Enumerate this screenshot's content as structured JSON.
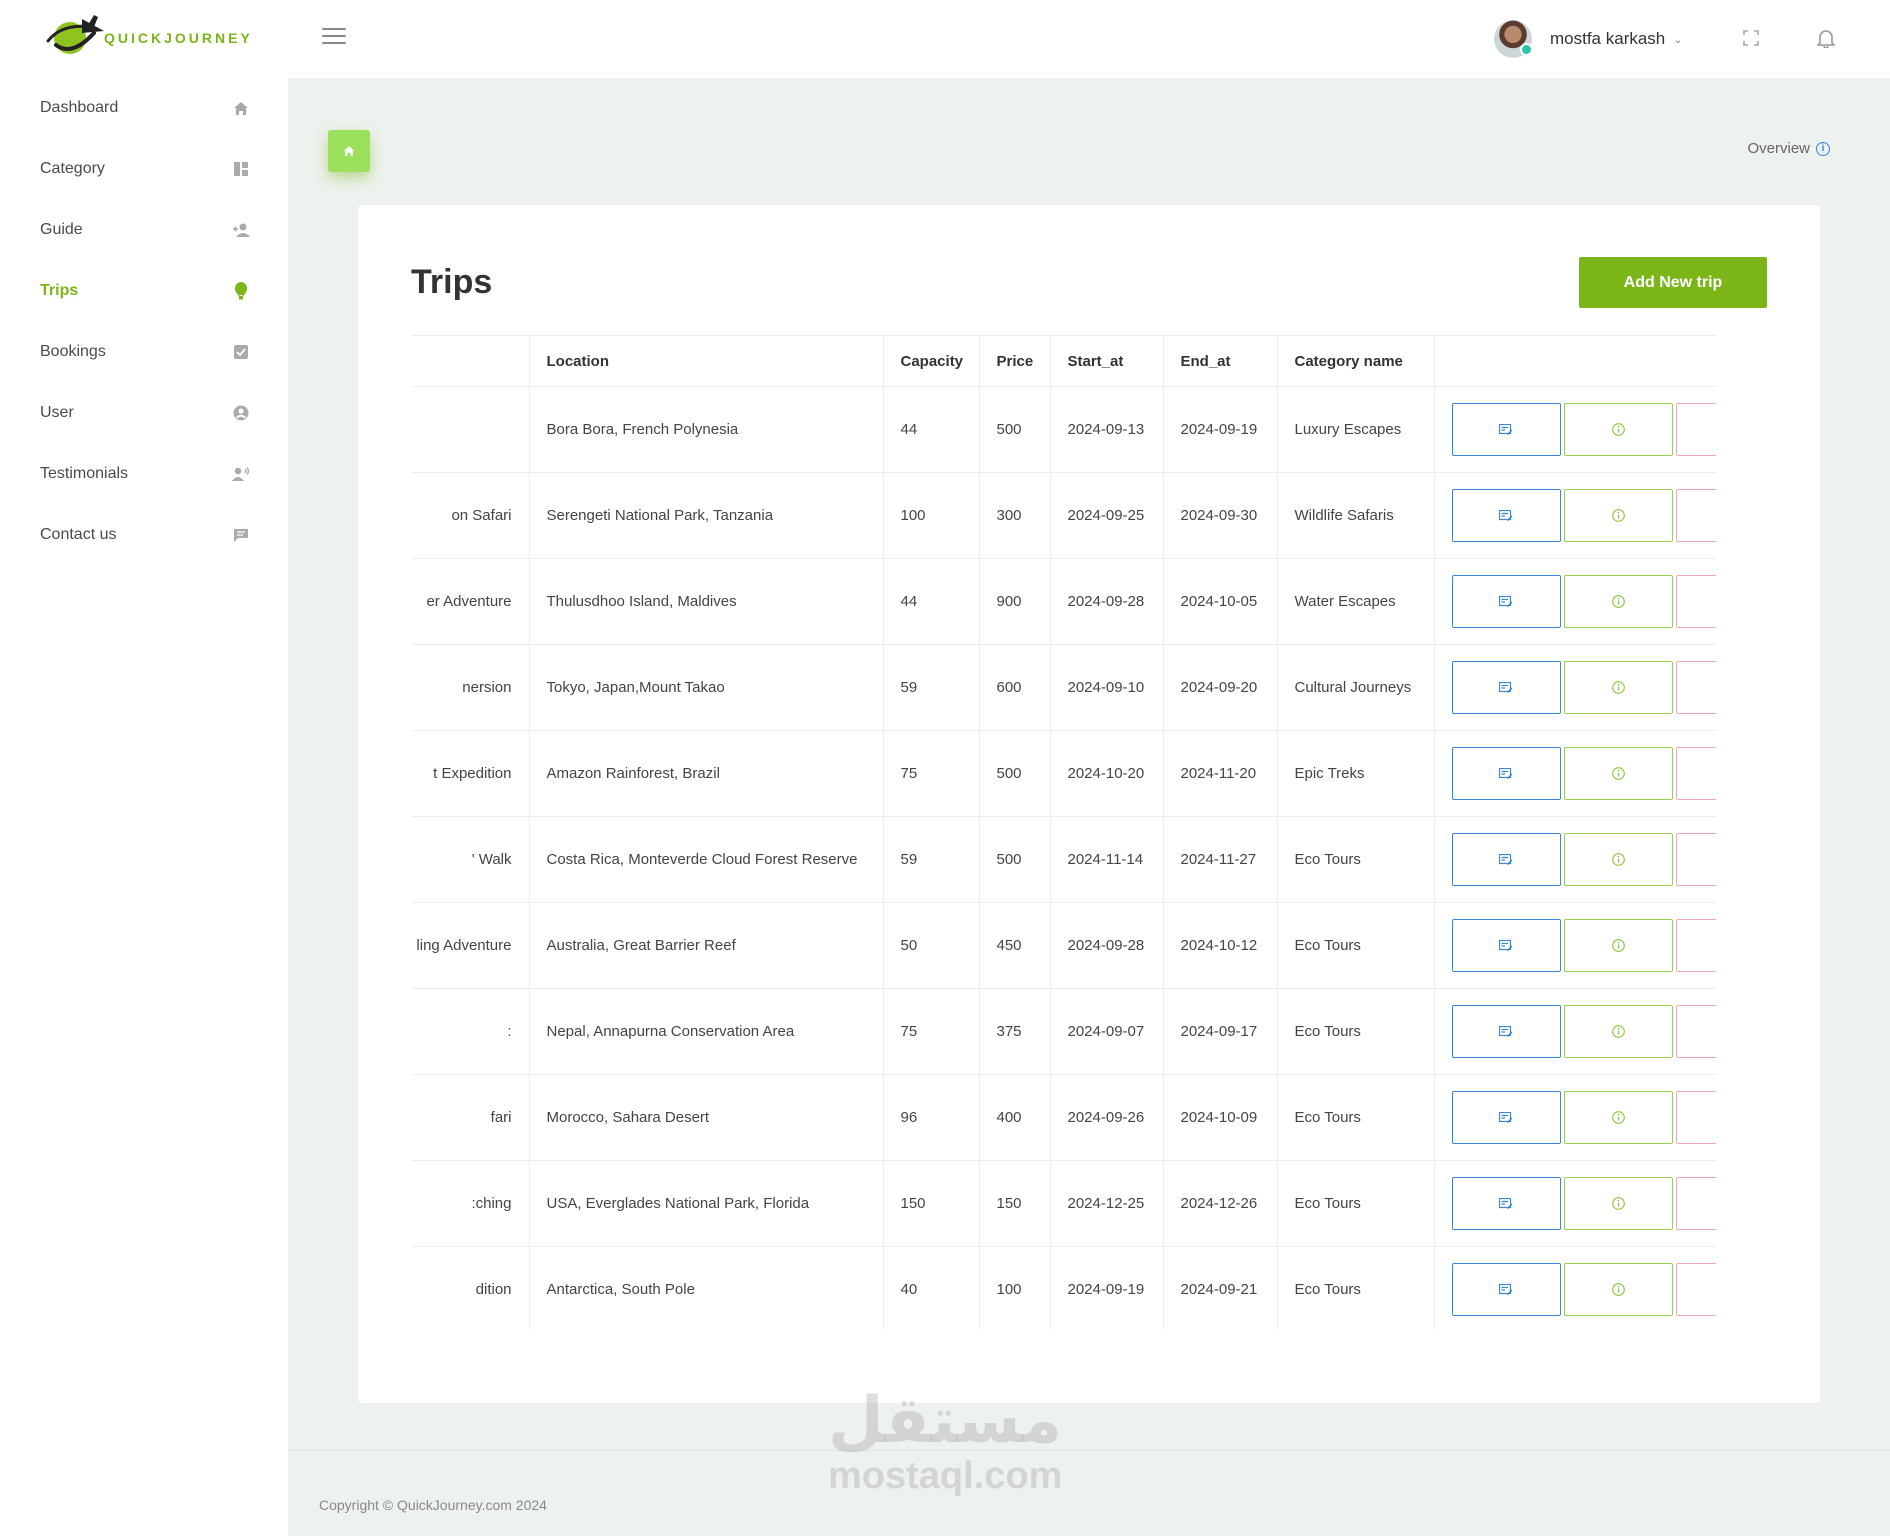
{
  "brand": {
    "name": "QUICKJOURNEY",
    "accent": "#7cb518"
  },
  "header": {
    "user_name": "mostfa karkash",
    "icons": [
      "menu-icon",
      "chevron-down-icon",
      "fullscreen-icon",
      "bell-icon"
    ]
  },
  "sidebar": {
    "items": [
      {
        "label": "Dashboard",
        "icon": "home-icon",
        "active": false
      },
      {
        "label": "Category",
        "icon": "grid-icon",
        "active": false
      },
      {
        "label": "Guide",
        "icon": "person-add-icon",
        "active": false
      },
      {
        "label": "Trips",
        "icon": "balloon-icon",
        "active": true
      },
      {
        "label": "Bookings",
        "icon": "checkbox-icon",
        "active": false
      },
      {
        "label": "User",
        "icon": "user-circle-icon",
        "active": false
      },
      {
        "label": "Testimonials",
        "icon": "person-voice-icon",
        "active": false
      },
      {
        "label": "Contact us",
        "icon": "chat-icon",
        "active": false
      }
    ]
  },
  "page": {
    "overview_label": "Overview",
    "title": "Trips",
    "add_button": "Add New trip"
  },
  "table": {
    "columns": [
      "",
      "Location",
      "Capacity",
      "Price",
      "Start_at",
      "End_at",
      "Category name",
      ""
    ],
    "rows": [
      {
        "name": "",
        "location": "Bora Bora, French Polynesia",
        "capacity": "44",
        "price": "500",
        "start": "2024-09-13",
        "end": "2024-09-19",
        "category": "Luxury Escapes"
      },
      {
        "name": "on Safari",
        "location": "Serengeti National Park, Tanzania",
        "capacity": "100",
        "price": "300",
        "start": "2024-09-25",
        "end": "2024-09-30",
        "category": "Wildlife Safaris"
      },
      {
        "name": "er Adventure",
        "location": "Thulusdhoo Island, Maldives",
        "capacity": "44",
        "price": "900",
        "start": "2024-09-28",
        "end": "2024-10-05",
        "category": "Water Escapes"
      },
      {
        "name": "nersion",
        "location": "Tokyo, Japan,Mount Takao",
        "capacity": "59",
        "price": "600",
        "start": "2024-09-10",
        "end": "2024-09-20",
        "category": "Cultural Journeys"
      },
      {
        "name": "t Expedition",
        "location": "Amazon Rainforest, Brazil",
        "capacity": "75",
        "price": "500",
        "start": "2024-10-20",
        "end": "2024-11-20",
        "category": "Epic Treks"
      },
      {
        "name": "' Walk",
        "location": "Costa Rica, Monteverde Cloud Forest Reserve",
        "capacity": "59",
        "price": "500",
        "start": "2024-11-14",
        "end": "2024-11-27",
        "category": "Eco Tours"
      },
      {
        "name": "ling Adventure",
        "location": "Australia, Great Barrier Reef",
        "capacity": "50",
        "price": "450",
        "start": "2024-09-28",
        "end": "2024-10-12",
        "category": "Eco Tours"
      },
      {
        "name": ":",
        "location": "Nepal, Annapurna Conservation Area",
        "capacity": "75",
        "price": "375",
        "start": "2024-09-07",
        "end": "2024-09-17",
        "category": "Eco Tours"
      },
      {
        "name": "fari",
        "location": "Morocco, Sahara Desert",
        "capacity": "96",
        "price": "400",
        "start": "2024-09-26",
        "end": "2024-10-09",
        "category": "Eco Tours"
      },
      {
        "name": ":ching",
        "location": "USA, Everglades National Park, Florida",
        "capacity": "150",
        "price": "150",
        "start": "2024-12-25",
        "end": "2024-12-26",
        "category": "Eco Tours"
      },
      {
        "name": "dition",
        "location": "Antarctica, South Pole",
        "capacity": "40",
        "price": "100",
        "start": "2024-09-19",
        "end": "2024-09-21",
        "category": "Eco Tours"
      }
    ],
    "row_actions": [
      "edit-icon",
      "info-icon",
      "trash-icon"
    ]
  },
  "footer": {
    "copyright": "Copyright © QuickJourney.com 2024"
  },
  "watermark": {
    "arabic": "مستقل",
    "latin": "mostaql.com"
  },
  "colors": {
    "edit": "#3a86d6",
    "info": "#9fcf4e",
    "delete": "#f07a92",
    "main_bg": "#eef2ee"
  }
}
